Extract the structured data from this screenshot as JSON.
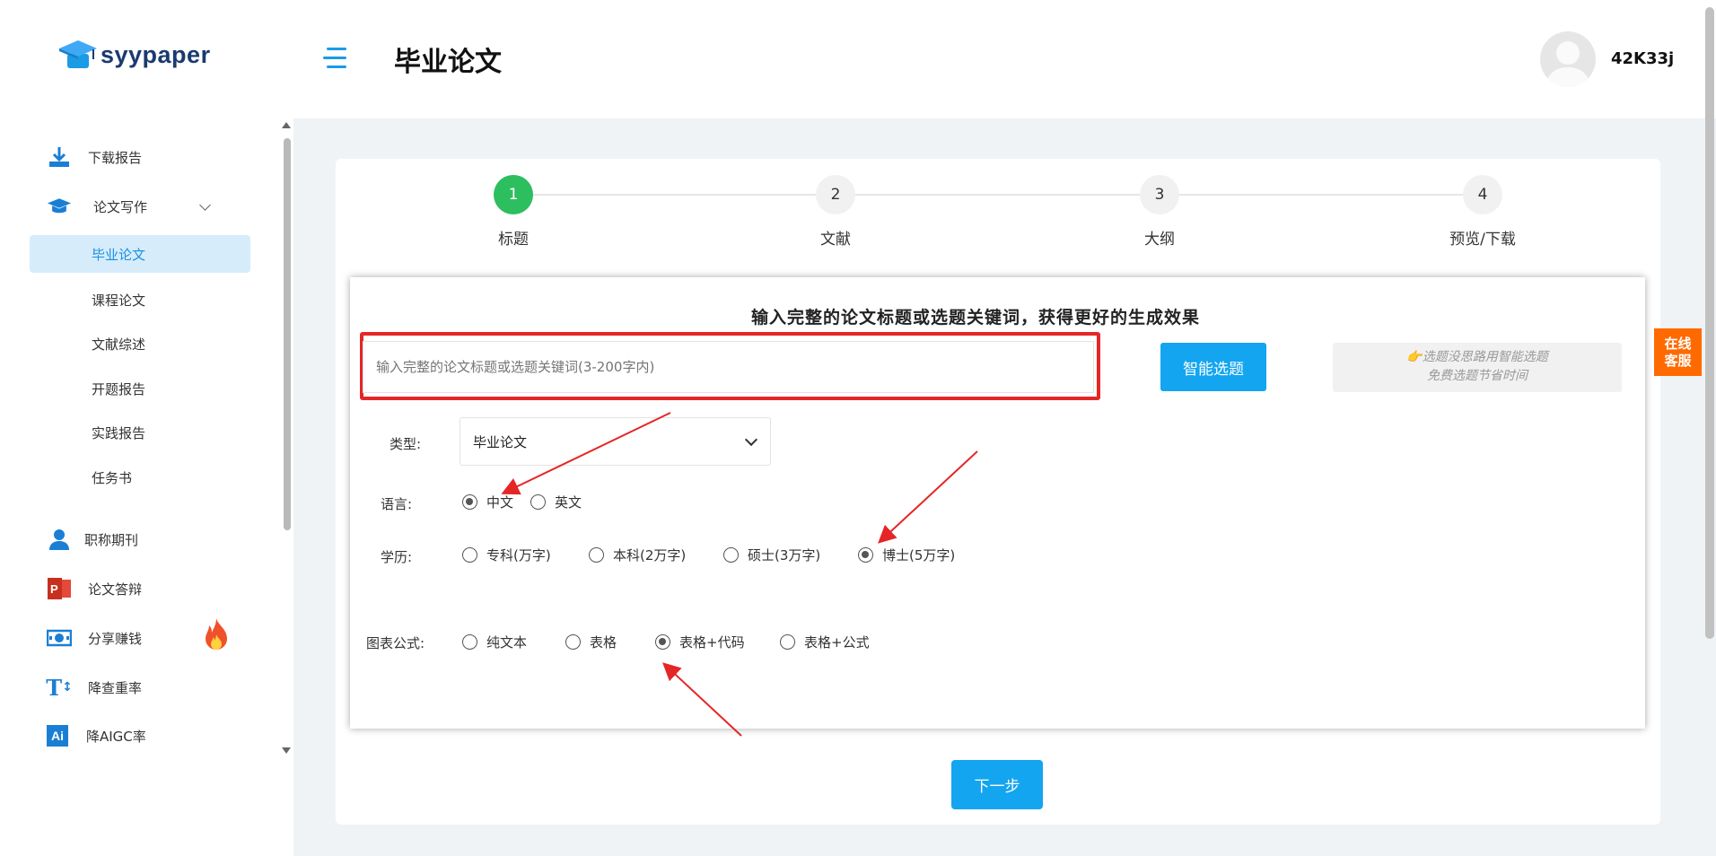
{
  "brand": {
    "name": "syypaper"
  },
  "sidebar": {
    "items": [
      {
        "label": "下载报告",
        "icon": "download-icon"
      },
      {
        "label": "论文写作",
        "icon": "graduation-cap-icon"
      },
      {
        "label": "职称期刊",
        "icon": "user-icon"
      },
      {
        "label": "论文答辩",
        "icon": "powerpoint-icon"
      },
      {
        "label": "分享赚钱",
        "icon": "money-icon"
      },
      {
        "label": "降查重率",
        "icon": "text-size-icon"
      },
      {
        "label": "降AIGC率",
        "icon": "ai-icon"
      }
    ],
    "sub_items": [
      {
        "label": "毕业论文"
      },
      {
        "label": "课程论文"
      },
      {
        "label": "文献综述"
      },
      {
        "label": "开题报告"
      },
      {
        "label": "实践报告"
      },
      {
        "label": "任务书"
      }
    ],
    "ai_icon_text": "Ai",
    "tt_icon_text": "T"
  },
  "header": {
    "title": "毕业论文",
    "username": "42K33j"
  },
  "steps": [
    {
      "num": "1",
      "label": "标题"
    },
    {
      "num": "2",
      "label": "文献"
    },
    {
      "num": "3",
      "label": "大纲"
    },
    {
      "num": "4",
      "label": "预览/下载"
    }
  ],
  "form": {
    "heading": "输入完整的论文标题或选题关键词，获得更好的生成效果",
    "title_placeholder": "输入完整的论文标题或选题关键词(3-200字内)",
    "smart_button": "智能选题",
    "tip_line1": "👉选题没思路用智能选题",
    "tip_line2": "免费选题节省时间",
    "type_label": "类型:",
    "type_value": "毕业论文",
    "lang_label": "语言:",
    "lang_options": [
      "中文",
      "英文"
    ],
    "edu_label": "学历:",
    "edu_options": [
      "专科(万字)",
      "本科(2万字)",
      "硕士(3万字)",
      "博士(5万字)"
    ],
    "chart_label": "图表公式:",
    "chart_options": [
      "纯文本",
      "表格",
      "表格+代码",
      "表格+公式"
    ],
    "next_button": "下一步"
  },
  "service": {
    "line1": "在线",
    "line2": "客服"
  },
  "colors": {
    "accent": "#13a5f0",
    "step_active": "#2dbe60",
    "highlight": "#e52626",
    "service": "#ff6a00"
  }
}
